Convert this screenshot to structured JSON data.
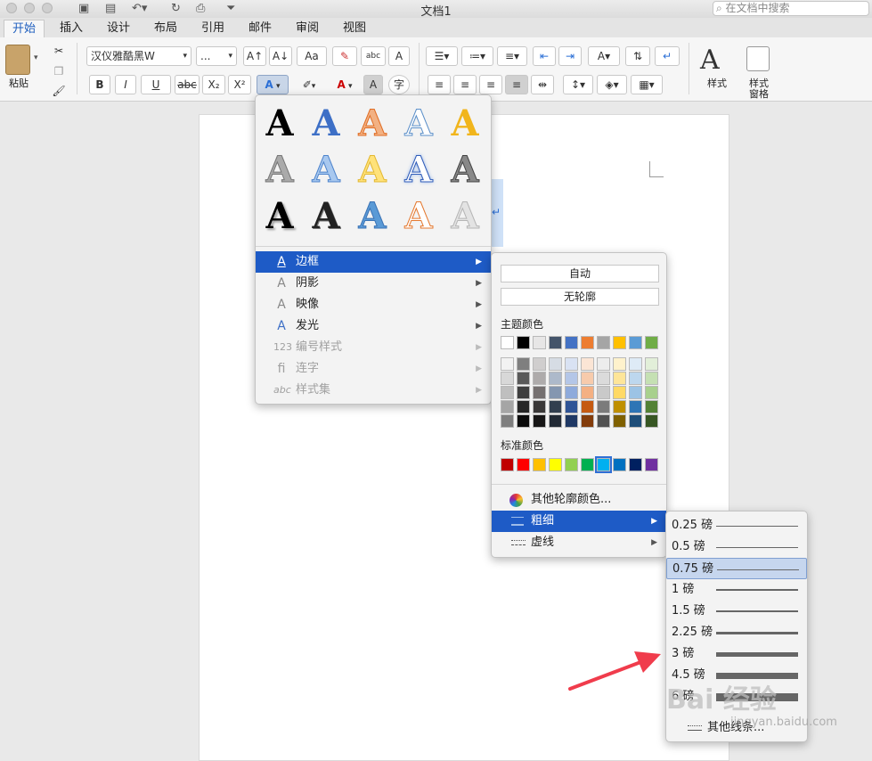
{
  "window": {
    "title": "文档1",
    "search_placeholder": "在文档中搜索"
  },
  "tabs": [
    {
      "label": "开始",
      "active": true
    },
    {
      "label": "插入"
    },
    {
      "label": "设计"
    },
    {
      "label": "布局"
    },
    {
      "label": "引用"
    },
    {
      "label": "邮件"
    },
    {
      "label": "审阅"
    },
    {
      "label": "视图"
    }
  ],
  "ribbon": {
    "paste_label": "粘贴",
    "font_name": "汉仪雅酷黑W",
    "font_size": "...",
    "bold": "B",
    "italic": "I",
    "underline": "U",
    "strike": "abc",
    "subscript": "X₂",
    "superscript": "X²",
    "styles_label": "样式",
    "styles_pane_label_1": "样式",
    "styles_pane_label_2": "窗格",
    "grow_font": "A↑",
    "shrink_font": "A↓",
    "change_case": "Aa",
    "phonetic": "abc",
    "char_shading": "A",
    "enclose_char": "字",
    "text_effect_icon": "A",
    "font_color_icon": "A"
  },
  "text_effects_menu": {
    "items": [
      {
        "label": "边框",
        "icon": "A",
        "highlighted": true,
        "enabled": true
      },
      {
        "label": "阴影",
        "icon": "A",
        "enabled": true
      },
      {
        "label": "映像",
        "icon": "A",
        "enabled": true
      },
      {
        "label": "发光",
        "icon": "A",
        "enabled": true
      },
      {
        "label": "编号样式",
        "icon": "123",
        "enabled": false
      },
      {
        "label": "连字",
        "icon": "fi",
        "enabled": false
      },
      {
        "label": "样式集",
        "icon": "abc",
        "enabled": false
      }
    ]
  },
  "outline_menu": {
    "auto": "自动",
    "no_outline": "无轮廓",
    "theme_colors_label": "主题颜色",
    "standard_colors_label": "标准颜色",
    "more_colors": "其他轮廓颜色...",
    "weight": "粗细",
    "dashes": "虚线",
    "theme_top": [
      "#ffffff",
      "#000000",
      "#e7e6e6",
      "#44546a",
      "#4472c4",
      "#ed7d31",
      "#a5a5a5",
      "#ffc000",
      "#5b9bd5",
      "#70ad47"
    ],
    "theme_shades": [
      [
        "#f2f2f2",
        "#7f7f7f",
        "#d0cece",
        "#d6dce4",
        "#d9e2f3",
        "#fbe5d5",
        "#ededed",
        "#fff2cc",
        "#deebf6",
        "#e2efd9"
      ],
      [
        "#d8d8d8",
        "#595959",
        "#aeabab",
        "#adb9ca",
        "#b4c6e7",
        "#f7cbac",
        "#dbdbdb",
        "#fee599",
        "#bdd7ee",
        "#c5e0b3"
      ],
      [
        "#bfbfbf",
        "#3f3f3f",
        "#757070",
        "#8496b0",
        "#8eaadb",
        "#f4b083",
        "#c9c9c9",
        "#ffd965",
        "#9cc3e5",
        "#a8d08d"
      ],
      [
        "#a5a5a5",
        "#262626",
        "#3a3838",
        "#323f4f",
        "#2f5496",
        "#c55a11",
        "#7b7b7b",
        "#bf8f00",
        "#2e75b5",
        "#538135"
      ],
      [
        "#7f7f7f",
        "#0c0c0c",
        "#171616",
        "#222a35",
        "#1f3864",
        "#833c0b",
        "#525252",
        "#7f6000",
        "#1e4e79",
        "#375623"
      ]
    ],
    "standard": [
      "#c00000",
      "#ff0000",
      "#ffc000",
      "#ffff00",
      "#92d050",
      "#00b050",
      "#00b0f0",
      "#0070c0",
      "#002060",
      "#7030a0"
    ]
  },
  "weight_menu": {
    "items": [
      {
        "label": "0.25 磅",
        "thickness": 0.25
      },
      {
        "label": "0.5 磅",
        "thickness": 0.5
      },
      {
        "label": "0.75 磅",
        "thickness": 0.75,
        "selected": true
      },
      {
        "label": "1 磅",
        "thickness": 1
      },
      {
        "label": "1.5 磅",
        "thickness": 1.5
      },
      {
        "label": "2.25 磅",
        "thickness": 2.25
      },
      {
        "label": "3 磅",
        "thickness": 3
      },
      {
        "label": "4.5 磅",
        "thickness": 4.5
      },
      {
        "label": "6 磅",
        "thickness": 6
      }
    ],
    "more_lines": "其他线条..."
  },
  "watermark": {
    "text": "Bai 经验",
    "url": "jingyan.baidu.com"
  }
}
